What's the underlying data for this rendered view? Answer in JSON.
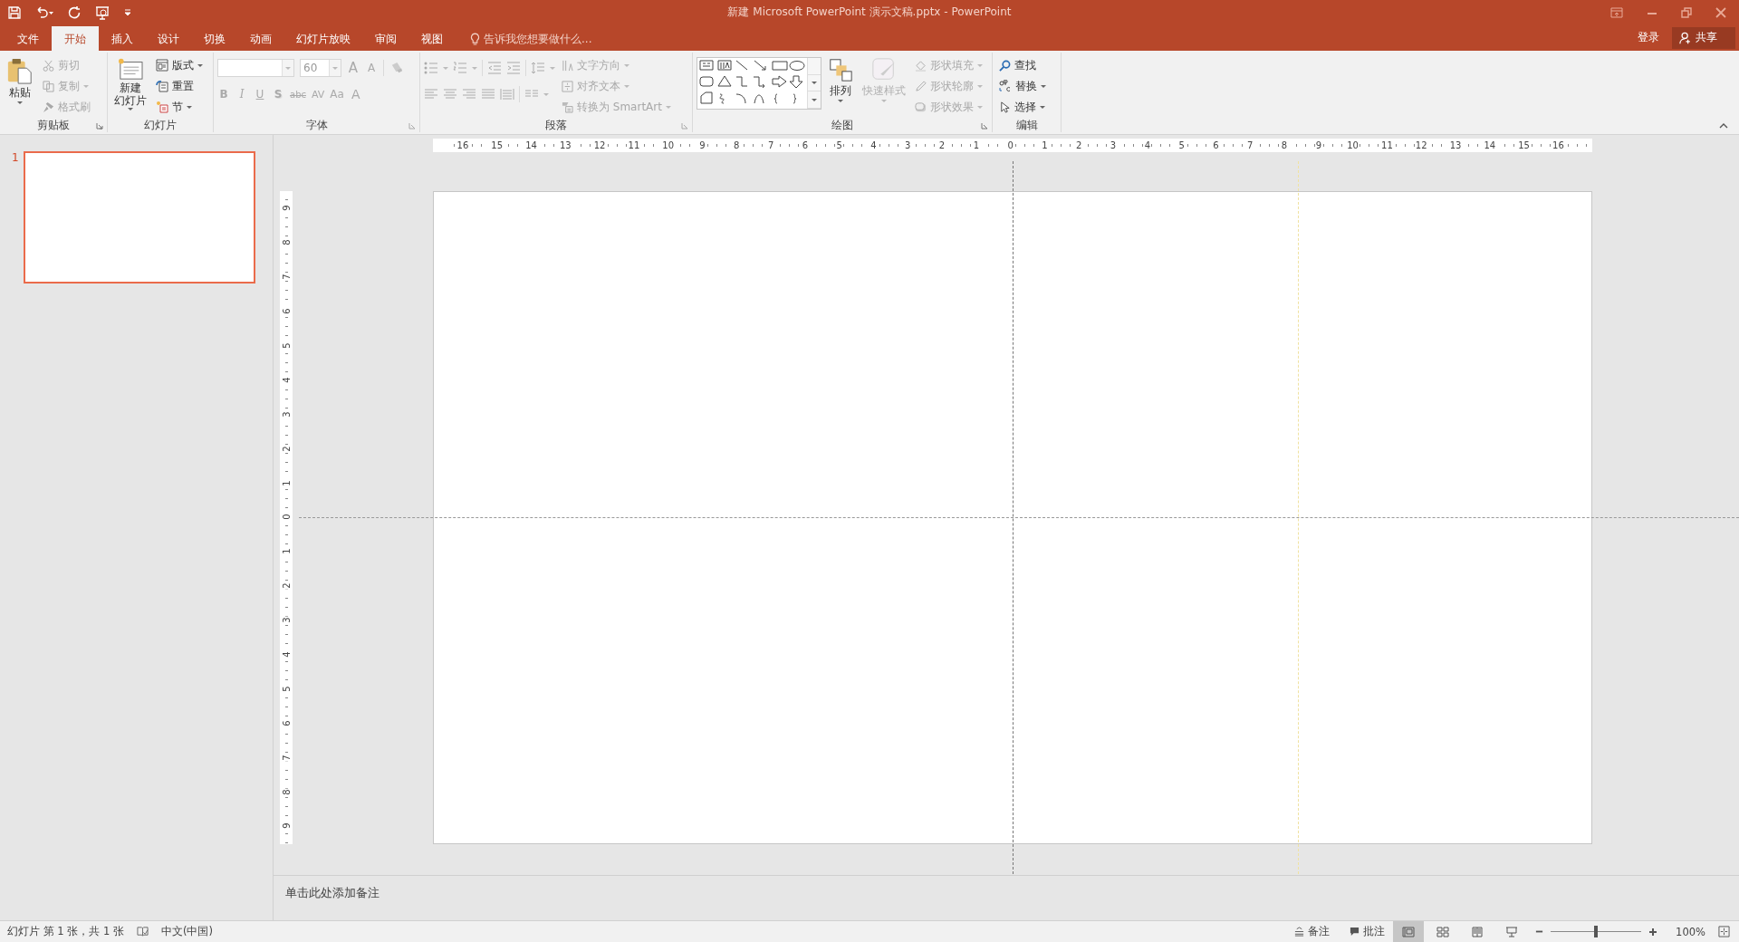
{
  "window": {
    "title": "新建 Microsoft PowerPoint 演示文稿.pptx - PowerPoint"
  },
  "tabs": [
    {
      "label": "文件",
      "selected": false
    },
    {
      "label": "开始",
      "selected": true
    },
    {
      "label": "插入",
      "selected": false
    },
    {
      "label": "设计",
      "selected": false
    },
    {
      "label": "切换",
      "selected": false
    },
    {
      "label": "动画",
      "selected": false
    },
    {
      "label": "幻灯片放映",
      "selected": false
    },
    {
      "label": "审阅",
      "selected": false
    },
    {
      "label": "视图",
      "selected": false
    }
  ],
  "tell_me": {
    "placeholder": "告诉我您想要做什么..."
  },
  "account": {
    "sign_in": "登录",
    "share": "共享"
  },
  "ribbon": {
    "clipboard": {
      "title": "剪贴板",
      "dialog_launcher": true,
      "paste": {
        "label": "粘贴",
        "disabled": false
      },
      "commands": [
        {
          "label": "剪切",
          "disabled": true,
          "dropdown": false
        },
        {
          "label": "复制",
          "disabled": true,
          "dropdown": true
        },
        {
          "label": "格式刷",
          "disabled": true,
          "dropdown": false
        }
      ]
    },
    "slides": {
      "title": "幻灯片",
      "new_slide": {
        "label_lines": [
          "新建",
          "幻灯片"
        ],
        "disabled": false
      },
      "commands": [
        {
          "label": "版式",
          "disabled": false,
          "dropdown": true
        },
        {
          "label": "重置",
          "disabled": false,
          "dropdown": false
        },
        {
          "label": "节",
          "disabled": false,
          "dropdown": true
        }
      ]
    },
    "font": {
      "title": "字体",
      "dialog_launcher": true,
      "disabled": true,
      "font_size": {
        "value": "60"
      },
      "size_buttons": [
        {
          "kind": "grow",
          "label": "A"
        },
        {
          "kind": "shrink",
          "label": "A"
        }
      ],
      "format_buttons": [
        {
          "kind": "bold",
          "label": "B"
        },
        {
          "kind": "italic",
          "label": "I"
        },
        {
          "kind": "underline",
          "label": "U"
        },
        {
          "kind": "shadow",
          "label": "S"
        },
        {
          "kind": "strikethrough",
          "label": "abc"
        },
        {
          "kind": "spacing",
          "label": "AV"
        },
        {
          "kind": "case",
          "label": "Aa"
        },
        {
          "kind": "color",
          "label": "A"
        }
      ]
    },
    "paragraph": {
      "title": "段落",
      "dialog_launcher": true,
      "disabled": true,
      "commands": [
        {
          "label": "文字方向",
          "dropdown": true
        },
        {
          "label": "对齐文本",
          "dropdown": true
        },
        {
          "label": "转换为 SmartArt",
          "dropdown": true
        }
      ]
    },
    "drawing": {
      "title": "绘图",
      "dialog_launcher": true,
      "arrange": {
        "label": "排列",
        "disabled": false
      },
      "quick_styles": {
        "label": "快速样式",
        "disabled": true
      },
      "commands": [
        {
          "label": "形状填充",
          "disabled": true,
          "dropdown": true
        },
        {
          "label": "形状轮廓",
          "disabled": true,
          "dropdown": true
        },
        {
          "label": "形状效果",
          "disabled": true,
          "dropdown": true
        }
      ]
    },
    "editing": {
      "title": "编辑",
      "commands": [
        {
          "label": "查找",
          "dropdown": false
        },
        {
          "label": "替换",
          "dropdown": true
        },
        {
          "label": "选择",
          "dropdown": true
        }
      ]
    }
  },
  "slides_panel": {
    "thumbnails": [
      {
        "number": "1",
        "selected": true
      }
    ]
  },
  "horizontal_ruler": {
    "labels": [
      "16",
      "15",
      "14",
      "13",
      "12",
      "11",
      "10",
      "9",
      "8",
      "7",
      "6",
      "5",
      "4",
      "3",
      "2",
      "1",
      "0",
      "1",
      "2",
      "3",
      "4",
      "5",
      "6",
      "7",
      "8",
      "9",
      "10",
      "11",
      "12",
      "13",
      "14",
      "15",
      "16"
    ]
  },
  "vertical_ruler": {
    "labels": [
      "9",
      "8",
      "7",
      "6",
      "5",
      "4",
      "3",
      "2",
      "1",
      "0",
      "1",
      "2",
      "3",
      "4",
      "5",
      "6",
      "7",
      "8",
      "9"
    ]
  },
  "notes": {
    "prompt": "单击此处添加备注"
  },
  "status_bar": {
    "slide_info": "幻灯片 第 1 张，共 1 张",
    "language": "中文(中国)",
    "notes": "备注",
    "comments": "批注",
    "views": [
      {
        "selected": true
      },
      {
        "selected": false
      },
      {
        "selected": false
      },
      {
        "selected": false
      }
    ],
    "zoom": {
      "level": 0.5,
      "reading": "100%"
    }
  }
}
